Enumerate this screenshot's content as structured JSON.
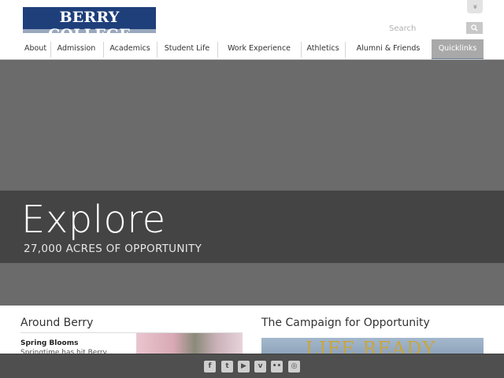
{
  "header": {
    "logo_text": "BERRY COLLEGE",
    "search_placeholder": "Search",
    "expand_label": "»"
  },
  "nav": {
    "items": [
      {
        "label": "About"
      },
      {
        "label": "Admission"
      },
      {
        "label": "Academics"
      },
      {
        "label": "Student Life"
      },
      {
        "label": "Work Experience"
      },
      {
        "label": "Athletics"
      },
      {
        "label": "Alumni & Friends"
      },
      {
        "label": "Quicklinks"
      }
    ]
  },
  "hero": {
    "title": "Explore",
    "subtitle": "27,000 ACRES OF OPPORTUNITY"
  },
  "around": {
    "title": "Around Berry",
    "story_title": "Spring Blooms",
    "story_text": "Springtime has hit Berry..."
  },
  "campaign": {
    "title": "The Campaign for Opportunity",
    "banner_text": "LIFE READY"
  },
  "social": {
    "icons": [
      "facebook-icon",
      "twitter-icon",
      "youtube-icon",
      "vimeo-icon",
      "flickr-icon",
      "instagram-icon"
    ],
    "glyphs": [
      "f",
      "t",
      "▶",
      "v",
      "••",
      "◎"
    ]
  },
  "colors": {
    "brand_navy": "#1e3f7a",
    "hero_gray": "#6b6b6b",
    "hero_band": "#444444",
    "footer_bar": "#4f4f4f"
  }
}
